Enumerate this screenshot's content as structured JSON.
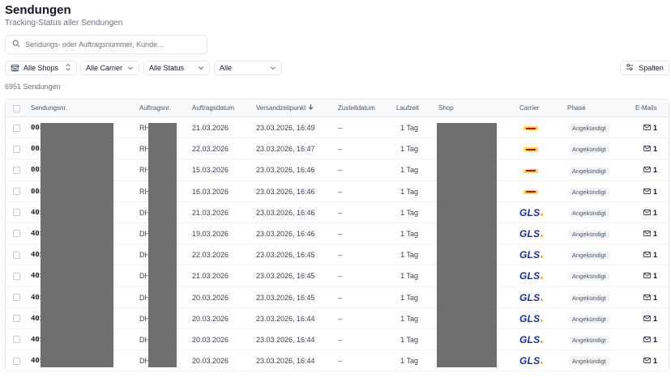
{
  "header": {
    "title": "Sendungen",
    "subtitle": "Tracking-Status aller Sendungen"
  },
  "search": {
    "placeholder": "Sendungs- oder Auftragsnummer, Kunde..."
  },
  "filters": {
    "shops": "Alle Shops",
    "carrier": "Alle Carrier",
    "status": "Alle Status",
    "other": "Alle"
  },
  "columns_button": "Spalten",
  "count_label": "6951 Sendungen",
  "table": {
    "headers": {
      "shipment_no": "Sendungsnr.",
      "order_no": "Auftragsnr.",
      "order_date": "Auftragsdatum",
      "ship_time": "Versandzeitpunkt",
      "delivery_date": "Zustelldatum",
      "transit": "Laufzeit",
      "shop": "Shop",
      "carrier": "Carrier",
      "phase": "Phase",
      "emails": "E-Mails"
    },
    "sort_column": "ship_time",
    "rows": [
      {
        "shipment_no": "003",
        "order_no": "RH",
        "order_date": "21.03.2026",
        "ship_time": "23.03.2026, 16:49",
        "delivery_date": "–",
        "transit": "1 Tag",
        "carrier": "DHL",
        "phase": "Angekündigt",
        "emails": "1"
      },
      {
        "shipment_no": "003",
        "order_no": "RH",
        "order_date": "22.03.2026",
        "ship_time": "23.03.2026, 16:47",
        "delivery_date": "–",
        "transit": "1 Tag",
        "carrier": "DHL",
        "phase": "Angekündigt",
        "emails": "1"
      },
      {
        "shipment_no": "003",
        "order_no": "RH",
        "order_date": "15.03.2026",
        "ship_time": "23.03.2026, 16:46",
        "delivery_date": "–",
        "transit": "1 Tag",
        "carrier": "DHL",
        "phase": "Angekündigt",
        "emails": "1"
      },
      {
        "shipment_no": "003",
        "order_no": "RH",
        "order_date": "16.03.2026",
        "ship_time": "23.03.2026, 16:46",
        "delivery_date": "–",
        "transit": "1 Tag",
        "carrier": "DHL",
        "phase": "Angekündigt",
        "emails": "1"
      },
      {
        "shipment_no": "401",
        "order_no": "DH",
        "order_date": "21.03.2026",
        "ship_time": "23.03.2026, 16:46",
        "delivery_date": "–",
        "transit": "1 Tag",
        "carrier": "GLS",
        "phase": "Angekündigt",
        "emails": "1"
      },
      {
        "shipment_no": "401",
        "order_no": "DH",
        "order_date": "19.03.2026",
        "ship_time": "23.03.2026, 16:46",
        "delivery_date": "–",
        "transit": "1 Tag",
        "carrier": "GLS",
        "phase": "Angekündigt",
        "emails": "1"
      },
      {
        "shipment_no": "401",
        "order_no": "DH",
        "order_date": "22.03.2026",
        "ship_time": "23.03.2026, 16:45",
        "delivery_date": "–",
        "transit": "1 Tag",
        "carrier": "GLS",
        "phase": "Angekündigt",
        "emails": "1"
      },
      {
        "shipment_no": "401",
        "order_no": "DH",
        "order_date": "21.03.2026",
        "ship_time": "23.03.2026, 16:45",
        "delivery_date": "–",
        "transit": "1 Tag",
        "carrier": "GLS",
        "phase": "Angekündigt",
        "emails": "1"
      },
      {
        "shipment_no": "401",
        "order_no": "DH",
        "order_date": "20.03.2026",
        "ship_time": "23.03.2026, 16:45",
        "delivery_date": "–",
        "transit": "1 Tag",
        "carrier": "GLS",
        "phase": "Angekündigt",
        "emails": "1"
      },
      {
        "shipment_no": "401",
        "order_no": "DH",
        "order_date": "20.03.2026",
        "ship_time": "23.03.2026, 16:44",
        "delivery_date": "–",
        "transit": "1 Tag",
        "carrier": "GLS",
        "phase": "Angekündigt",
        "emails": "1"
      },
      {
        "shipment_no": "401",
        "order_no": "DH",
        "order_date": "20.03.2026",
        "ship_time": "23.03.2026, 16:44",
        "delivery_date": "–",
        "transit": "1 Tag",
        "carrier": "GLS",
        "phase": "Angekündigt",
        "emails": "1"
      },
      {
        "shipment_no": "401",
        "order_no": "DH",
        "order_date": "20.03.2026",
        "ship_time": "23.03.2026, 16:44",
        "delivery_date": "–",
        "transit": "1 Tag",
        "carrier": "GLS",
        "phase": "Angekündigt",
        "emails": "1"
      }
    ]
  },
  "icons": {
    "search": "search-icon",
    "shop": "store-icon",
    "chevron": "chevron-down-icon",
    "updown": "chevron-up-down-icon",
    "columns": "sliders-icon",
    "sort": "arrow-down-icon",
    "mail": "mail-icon"
  },
  "colors": {
    "gls_blue": "#1c2f96",
    "gls_yellow": "#f6b800",
    "dhl_yellow": "#fbd94f",
    "dhl_red": "#d40511",
    "redaction": "#6f6f6f"
  }
}
